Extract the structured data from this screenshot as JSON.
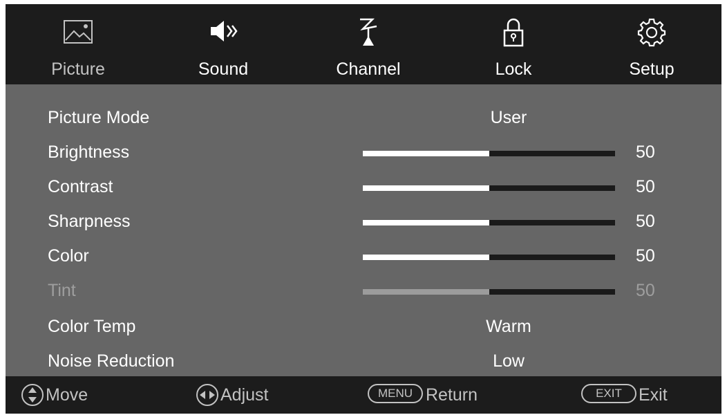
{
  "tabs": [
    {
      "label": "Picture",
      "icon": "picture-icon",
      "active": true
    },
    {
      "label": "Sound",
      "icon": "speaker-icon",
      "active": false
    },
    {
      "label": "Channel",
      "icon": "antenna-icon",
      "active": false
    },
    {
      "label": "Lock",
      "icon": "lock-icon",
      "active": false
    },
    {
      "label": "Setup",
      "icon": "gear-icon",
      "active": false
    }
  ],
  "settings": {
    "picture_mode": {
      "label": "Picture Mode",
      "value": "User"
    },
    "brightness": {
      "label": "Brightness",
      "value": 50,
      "max": 100
    },
    "contrast": {
      "label": "Contrast",
      "value": 50,
      "max": 100
    },
    "sharpness": {
      "label": "Sharpness",
      "value": 50,
      "max": 100
    },
    "color": {
      "label": "Color",
      "value": 50,
      "max": 100
    },
    "tint": {
      "label": "Tint",
      "value": 50,
      "max": 100,
      "disabled": true
    },
    "color_temp": {
      "label": "Color Temp",
      "value": "Warm"
    },
    "noise_reduction": {
      "label": "Noise Reduction",
      "value": "Low"
    }
  },
  "help": {
    "move": {
      "label": "Move",
      "icon": "up-down-arrows-icon"
    },
    "adjust": {
      "label": "Adjust",
      "icon": "left-right-arrows-icon"
    },
    "return": {
      "key": "MENU",
      "label": "Return"
    },
    "exit": {
      "key": "EXIT",
      "label": "Exit"
    }
  },
  "colors": {
    "bar_background": "#1c1c1c",
    "panel_background": "#666666",
    "text": "#ffffff",
    "inactive_text": "#9e9e9e",
    "slider_track": "#1a1a1a"
  }
}
